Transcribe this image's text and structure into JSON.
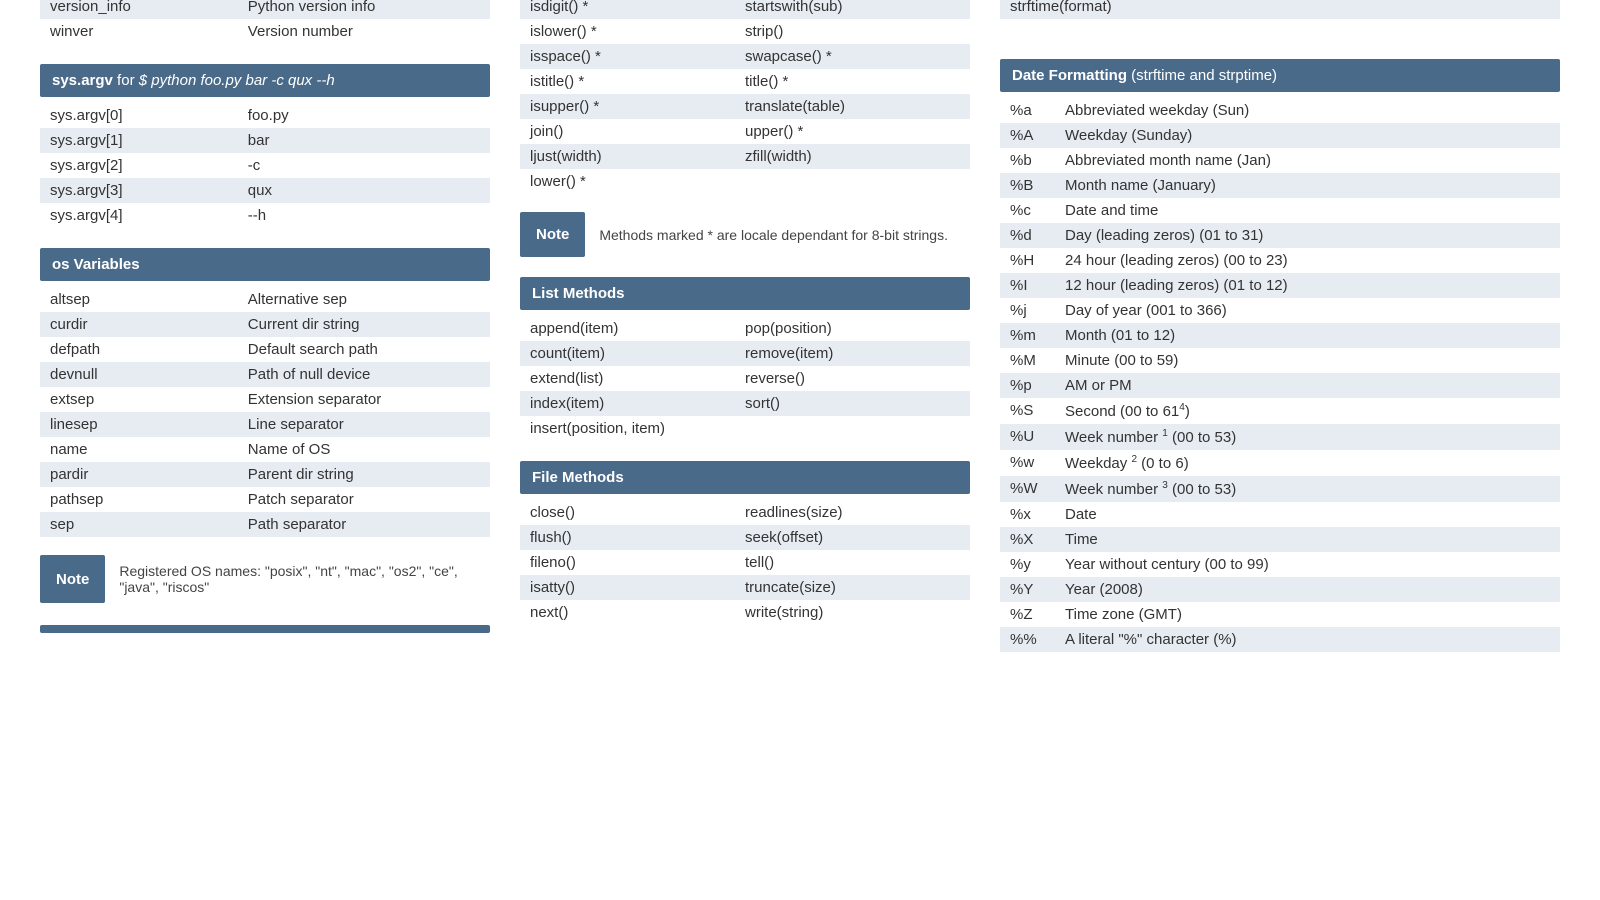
{
  "col1": {
    "top_rows": [
      {
        "k": "version_info",
        "v": "Python version info"
      },
      {
        "k": "winver",
        "v": "Version number"
      }
    ],
    "argv_header_bold": "sys.argv",
    "argv_header_for": " for ",
    "argv_header_cmd": "$ python foo.py bar -c qux --h",
    "argv_rows": [
      {
        "k": "sys.argv[0]",
        "v": "foo.py"
      },
      {
        "k": "sys.argv[1]",
        "v": "bar"
      },
      {
        "k": "sys.argv[2]",
        "v": "-c"
      },
      {
        "k": "sys.argv[3]",
        "v": "qux"
      },
      {
        "k": "sys.argv[4]",
        "v": "--h"
      }
    ],
    "osvar_header": "os Variables",
    "osvar_rows": [
      {
        "k": "altsep",
        "v": "Alternative sep"
      },
      {
        "k": "curdir",
        "v": "Current dir string"
      },
      {
        "k": "defpath",
        "v": "Default search path"
      },
      {
        "k": "devnull",
        "v": "Path of null device"
      },
      {
        "k": "extsep",
        "v": "Extension separator"
      },
      {
        "k": "linesep",
        "v": "Line separator"
      },
      {
        "k": "name",
        "v": "Name of OS"
      },
      {
        "k": "pardir",
        "v": "Parent dir string"
      },
      {
        "k": "pathsep",
        "v": "Patch separator"
      },
      {
        "k": "sep",
        "v": "Path separator"
      }
    ],
    "note_label": "Note",
    "note_body": "Registered OS names: \"posix\", \"nt\", \"mac\", \"os2\", \"ce\", \"java\", \"riscos\""
  },
  "col2": {
    "str_rows": [
      {
        "a": "isdigit() *",
        "b": "startswith(sub)"
      },
      {
        "a": "islower() *",
        "b": "strip()"
      },
      {
        "a": "isspace() *",
        "b": "swapcase() *"
      },
      {
        "a": "istitle() *",
        "b": "title() *"
      },
      {
        "a": "isupper() *",
        "b": "translate(table)"
      },
      {
        "a": "join()",
        "b": "upper() *"
      },
      {
        "a": "ljust(width)",
        "b": "zfill(width)"
      },
      {
        "a": "lower() *",
        "b": ""
      }
    ],
    "note_label": "Note",
    "note_body": "Methods marked * are locale dependant for 8-bit strings.",
    "list_header": "List Methods",
    "list_rows": [
      {
        "a": "append(item)",
        "b": "pop(position)"
      },
      {
        "a": "count(item)",
        "b": "remove(item)"
      },
      {
        "a": "extend(list)",
        "b": "reverse()"
      },
      {
        "a": "index(item)",
        "b": "sort()"
      },
      {
        "a": "insert(position, item)",
        "b": ""
      }
    ],
    "file_header": "File Methods",
    "file_rows": [
      {
        "a": "close()",
        "b": "readlines(size)"
      },
      {
        "a": "flush()",
        "b": "seek(offset)"
      },
      {
        "a": "fileno()",
        "b": "tell()"
      },
      {
        "a": "isatty()",
        "b": "truncate(size)"
      },
      {
        "a": "next()",
        "b": "write(string)"
      }
    ]
  },
  "col3": {
    "top_row": "strftime(format)",
    "fmt_header_bold": "Date Formatting",
    "fmt_header_sub": " (strftime and strptime)",
    "fmt_rows": [
      {
        "k": "%a",
        "v": "Abbreviated weekday (Sun)"
      },
      {
        "k": "%A",
        "v": "Weekday (Sunday)"
      },
      {
        "k": "%b",
        "v": "Abbreviated month name (Jan)"
      },
      {
        "k": "%B",
        "v": "Month name (January)"
      },
      {
        "k": "%c",
        "v": "Date and time"
      },
      {
        "k": "%d",
        "v": "Day (leading zeros) (01 to 31)"
      },
      {
        "k": "%H",
        "v": "24 hour (leading zeros) (00 to 23)"
      },
      {
        "k": "%I",
        "v": "12 hour (leading zeros) (01 to 12)"
      },
      {
        "k": "%j",
        "v": "Day of year (001 to 366)"
      },
      {
        "k": "%m",
        "v": "Month (01 to 12)"
      },
      {
        "k": "%M",
        "v": "Minute (00 to 59)"
      },
      {
        "k": "%p",
        "v": "AM or PM"
      },
      {
        "k": "%S",
        "v": "Second (00 to 61⁴)",
        "sup": "4",
        "pre": "Second (00 to 61",
        "post": ")"
      },
      {
        "k": "%U",
        "v": "Week number ¹ (00 to 53)",
        "sup": "1",
        "pre": "Week number ",
        "post": " (00 to 53)"
      },
      {
        "k": "%w",
        "v": "Weekday ² (0 to 6)",
        "sup": "2",
        "pre": "Weekday ",
        "post": " (0 to 6)"
      },
      {
        "k": "%W",
        "v": "Week number ³ (00 to 53)",
        "sup": "3",
        "pre": "Week number ",
        "post": " (00 to 53)"
      },
      {
        "k": "%x",
        "v": "Date"
      },
      {
        "k": "%X",
        "v": "Time"
      },
      {
        "k": "%y",
        "v": "Year without century (00 to 99)"
      },
      {
        "k": "%Y",
        "v": "Year (2008)"
      },
      {
        "k": "%Z",
        "v": "Time zone (GMT)"
      },
      {
        "k": "%%",
        "v": "A literal \"%\" character (%)"
      }
    ]
  }
}
